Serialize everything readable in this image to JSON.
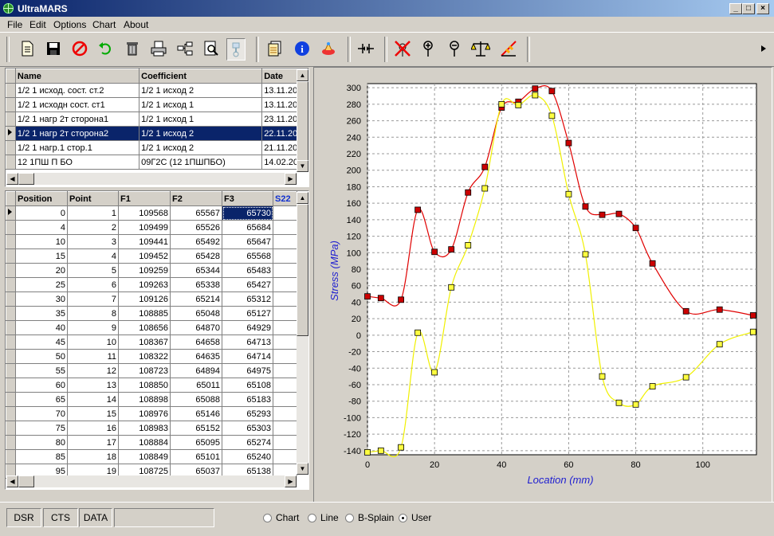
{
  "window": {
    "title": "UltraMARS"
  },
  "menu": [
    "File",
    "Edit",
    "Options",
    "Chart",
    "About"
  ],
  "toolbar": {
    "icons": [
      "new-icon",
      "save-icon",
      "stop-icon",
      "undo-icon",
      "delete-icon",
      "print-icon",
      "tree-icon",
      "preview-icon",
      "tool-icon",
      "report-icon",
      "info-icon",
      "weight-icon",
      "split-icon",
      "cross-icon",
      "pin-icon",
      "pin2-icon",
      "balance-icon",
      "measure-icon",
      "more-icon"
    ]
  },
  "top_grid": {
    "columns": [
      "Name",
      "Coefficient",
      "Date"
    ],
    "rows": [
      {
        "name": "1/2  1 исход. сост. ст.2",
        "coef": "1/2 1 исход 2",
        "date": "13.11.20"
      },
      {
        "name": "1/2  1 исходн сост. ст1",
        "coef": "1/2 1 исход 1",
        "date": "13.11.20"
      },
      {
        "name": "1/2  1 нагр 2т сторона1",
        "coef": "1/2 1 исход 1",
        "date": "23.11.20"
      },
      {
        "name": "1/2  1 нагр 2т сторона2",
        "coef": "1/2 1 исход 2",
        "date": "22.11.20"
      },
      {
        "name": "1/2  1 нагр.1 стор.1",
        "coef": "1/2 1 исход 2",
        "date": "21.11.20"
      },
      {
        "name": "12 1ПШ П БО",
        "coef": "09Г2С (12 1ПШПБО)",
        "date": "14.02.20"
      }
    ],
    "selected_row": 3
  },
  "bottom_grid": {
    "columns": [
      "Position",
      "Point",
      "F1",
      "F2",
      "F3",
      "S22"
    ],
    "rows": [
      [
        "0",
        "1",
        "109568",
        "65567",
        "65730"
      ],
      [
        "4",
        "2",
        "109499",
        "65526",
        "65684"
      ],
      [
        "10",
        "3",
        "109441",
        "65492",
        "65647"
      ],
      [
        "15",
        "4",
        "109452",
        "65428",
        "65568"
      ],
      [
        "20",
        "5",
        "109259",
        "65344",
        "65483"
      ],
      [
        "25",
        "6",
        "109263",
        "65338",
        "65427"
      ],
      [
        "30",
        "7",
        "109126",
        "65214",
        "65312"
      ],
      [
        "35",
        "8",
        "108885",
        "65048",
        "65127"
      ],
      [
        "40",
        "9",
        "108656",
        "64870",
        "64929"
      ],
      [
        "45",
        "10",
        "108367",
        "64658",
        "64713"
      ],
      [
        "50",
        "11",
        "108322",
        "64635",
        "64714"
      ],
      [
        "55",
        "12",
        "108723",
        "64894",
        "64975"
      ],
      [
        "60",
        "13",
        "108850",
        "65011",
        "65108"
      ],
      [
        "65",
        "14",
        "108898",
        "65088",
        "65183"
      ],
      [
        "70",
        "15",
        "108976",
        "65146",
        "65293"
      ],
      [
        "75",
        "16",
        "108983",
        "65152",
        "65303"
      ],
      [
        "80",
        "17",
        "108884",
        "65095",
        "65274"
      ],
      [
        "85",
        "18",
        "108849",
        "65101",
        "65240"
      ],
      [
        "95",
        "19",
        "108725",
        "65037",
        "65138"
      ]
    ]
  },
  "chart_data": {
    "type": "scatter",
    "xlabel": "Location (mm)",
    "ylabel": "Stress (MPa)",
    "xlim": [
      0,
      116
    ],
    "ylim": [
      -145,
      305
    ],
    "xticks": [
      0,
      20,
      40,
      60,
      80,
      100
    ],
    "yticks": [
      -140,
      -120,
      -100,
      -80,
      -60,
      -40,
      -20,
      0,
      20,
      40,
      60,
      80,
      100,
      120,
      140,
      160,
      180,
      200,
      220,
      240,
      260,
      280,
      300
    ],
    "grid": true,
    "series": [
      {
        "color": "#e00000",
        "marker_color": "#cc0000",
        "x": [
          0,
          4,
          10,
          15,
          20,
          25,
          30,
          35,
          40,
          45,
          50,
          55,
          60,
          65,
          70,
          75,
          80,
          85,
          95,
          105,
          115
        ],
        "y": [
          47,
          45,
          43,
          152,
          101,
          104,
          173,
          204,
          276,
          283,
          299,
          296,
          233,
          156,
          146,
          147,
          130,
          87,
          29,
          31,
          24
        ]
      },
      {
        "color": "#f0f000",
        "marker_color": "#ffff40",
        "x": [
          0,
          4,
          10,
          15,
          20,
          25,
          30,
          35,
          40,
          45,
          50,
          55,
          60,
          65,
          70,
          75,
          80,
          85,
          95,
          105,
          115
        ],
        "y": [
          -142,
          -140,
          -136,
          3,
          -45,
          58,
          109,
          178,
          280,
          279,
          291,
          266,
          171,
          98,
          -50,
          -82,
          -84,
          -62,
          -51,
          -11,
          4
        ]
      }
    ]
  },
  "status": {
    "panels": [
      "DSR",
      "CTS",
      "DATA",
      ""
    ],
    "radios": [
      "Chart",
      "Line",
      "B-Splain",
      "User"
    ],
    "selected_radio": 3
  }
}
